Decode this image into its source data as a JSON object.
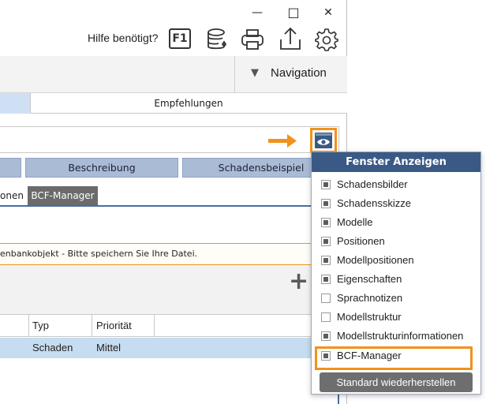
{
  "window": {
    "minimize_glyph": "—",
    "maximize_glyph": "□",
    "close_glyph": "✕"
  },
  "toolbar": {
    "help_text": "Hilfe benötigt?",
    "f1_label": "F1"
  },
  "nav": {
    "arrow_glyph": "▼",
    "label": "Navigation"
  },
  "tabs": {
    "empfehlungen": "Empfehlungen"
  },
  "buttons": {
    "beschreibung": "Beschreibung",
    "schadensbeispiel": "Schadensbeispiel"
  },
  "subtabs": {
    "partial": "onen",
    "bcf": "BCF-Manager"
  },
  "notice": "enbankobjekt - Bitte speichern Sie Ihre Datei.",
  "add_glyph": "+",
  "table": {
    "headers": [
      "Typ",
      "Priorität"
    ],
    "row": [
      "Schaden",
      "Mittel"
    ]
  },
  "popup": {
    "title": "Fenster Anzeigen",
    "items": [
      {
        "label": "Schadensbilder",
        "checked": true
      },
      {
        "label": "Schadensskizze",
        "checked": true
      },
      {
        "label": "Modelle",
        "checked": true
      },
      {
        "label": "Positionen",
        "checked": true
      },
      {
        "label": "Modellpositionen",
        "checked": true
      },
      {
        "label": "Eigenschaften",
        "checked": true
      },
      {
        "label": "Sprachnotizen",
        "checked": false
      },
      {
        "label": "Modellstruktur",
        "checked": false
      },
      {
        "label": "Modellstrukturinformationen",
        "checked": true
      },
      {
        "label": "BCF-Manager",
        "checked": true
      }
    ],
    "reset_label": "Standard wiederherstellen"
  },
  "colors": {
    "accent_orange": "#f0921c",
    "header_blue": "#3a5a85",
    "button_blue": "#aabbd6",
    "row_highlight": "#c6dcf0",
    "dark_tab": "#6b6b6b"
  }
}
